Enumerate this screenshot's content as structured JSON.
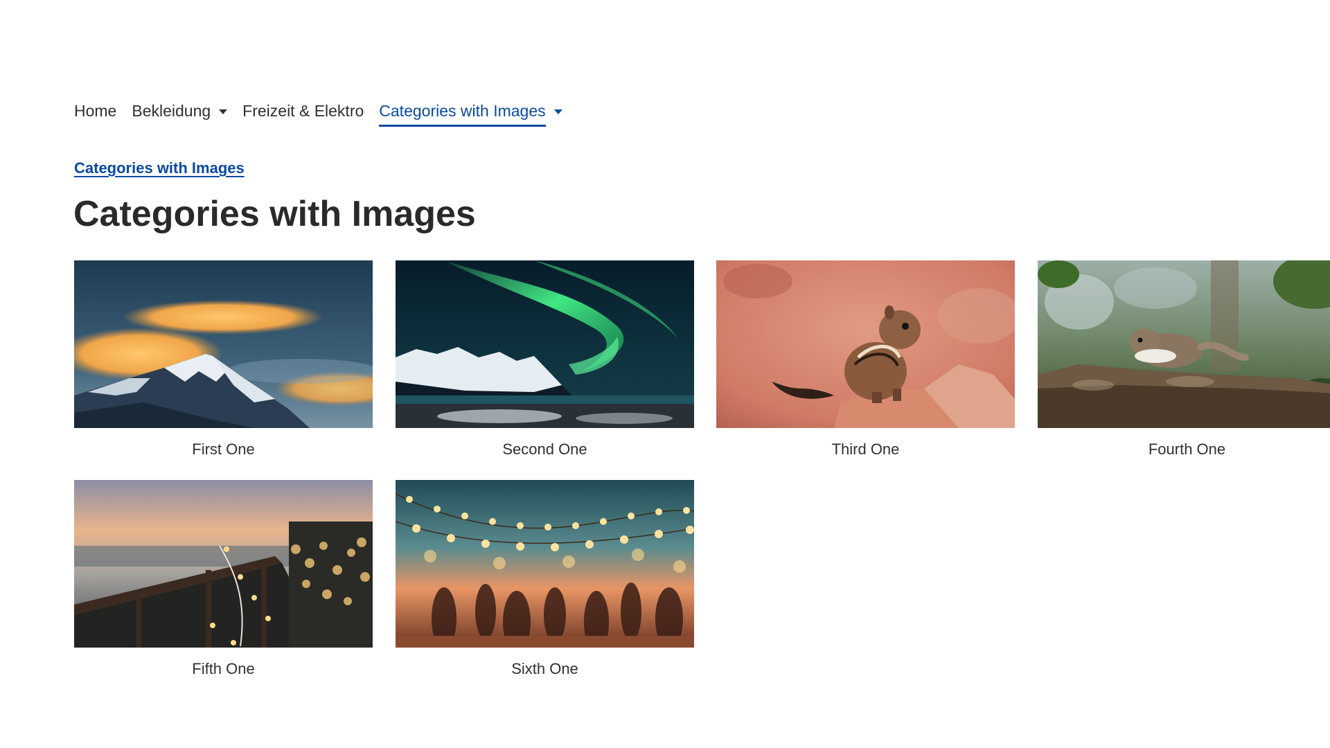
{
  "nav": {
    "items": [
      {
        "label": "Home",
        "has_dropdown": false,
        "active": false
      },
      {
        "label": "Bekleidung",
        "has_dropdown": true,
        "active": false
      },
      {
        "label": "Freizeit & Elektro",
        "has_dropdown": false,
        "active": false
      },
      {
        "label": "Categories with Images",
        "has_dropdown": true,
        "active": true
      }
    ]
  },
  "breadcrumb": {
    "label": "Categories with Images"
  },
  "page": {
    "title": "Categories with Images"
  },
  "categories": [
    {
      "label": "First One",
      "image": "mountain-lenticular-clouds"
    },
    {
      "label": "Second One",
      "image": "aurora-snowy-mountains"
    },
    {
      "label": "Third One",
      "image": "chipmunk-red-rock"
    },
    {
      "label": "Fourth One",
      "image": "squirrel-on-log"
    },
    {
      "label": "Fifth One",
      "image": "string-lights-balcony"
    },
    {
      "label": "Sixth One",
      "image": "beach-party-lights"
    }
  ],
  "colors": {
    "accent": "#0a4aa0",
    "text": "#2a2a2a",
    "background": "#ffffff"
  }
}
